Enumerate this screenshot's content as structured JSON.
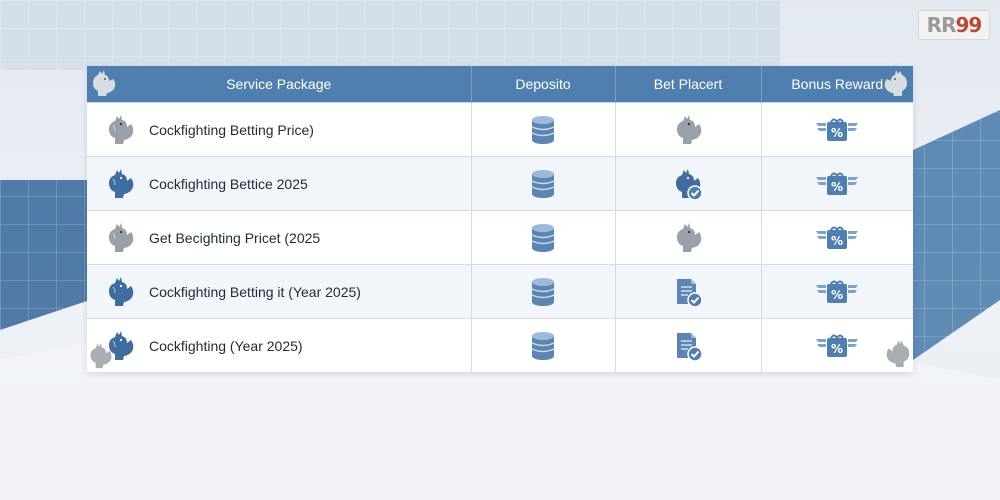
{
  "brand": {
    "logo_text_a": "RR",
    "logo_text_b": "99"
  },
  "table": {
    "headers": [
      "Service Package",
      "Deposito",
      "Bet Placert",
      "Bonus Reward"
    ],
    "rows": [
      {
        "package": "Cockfighting Betting Price)",
        "pkg_icon": "rooster-gray-icon",
        "deposit_icon": "database-icon",
        "bet_icon": "rooster-gray-icon",
        "bonus_icon": "gift-percent-icon"
      },
      {
        "package": "Cockfighting Bettice 2025",
        "pkg_icon": "rooster-blue-icon",
        "deposit_icon": "database-icon",
        "bet_icon": "rooster-check-icon",
        "bonus_icon": "gift-percent-icon"
      },
      {
        "package": "Get Becighting Pricet (2025",
        "pkg_icon": "rooster-gray-icon",
        "deposit_icon": "database-icon",
        "bet_icon": "rooster-gray-icon",
        "bonus_icon": "gift-percent-icon"
      },
      {
        "package": "Cockfighting Betting it (Year 2025)",
        "pkg_icon": "rooster-blue-icon",
        "deposit_icon": "database-icon",
        "bet_icon": "document-check-icon",
        "bonus_icon": "gift-percent-icon"
      },
      {
        "package": "Cockfighting (Year 2025)",
        "pkg_icon": "rooster-blue-icon",
        "deposit_icon": "database-icon",
        "bet_icon": "document-check-icon",
        "bonus_icon": "gift-percent-icon"
      }
    ]
  },
  "colors": {
    "header": "#4f7fae",
    "accent_blue": "#3f6d9f",
    "gray_icon": "#9aa0a8",
    "row_alt": "#f2f6fa"
  }
}
